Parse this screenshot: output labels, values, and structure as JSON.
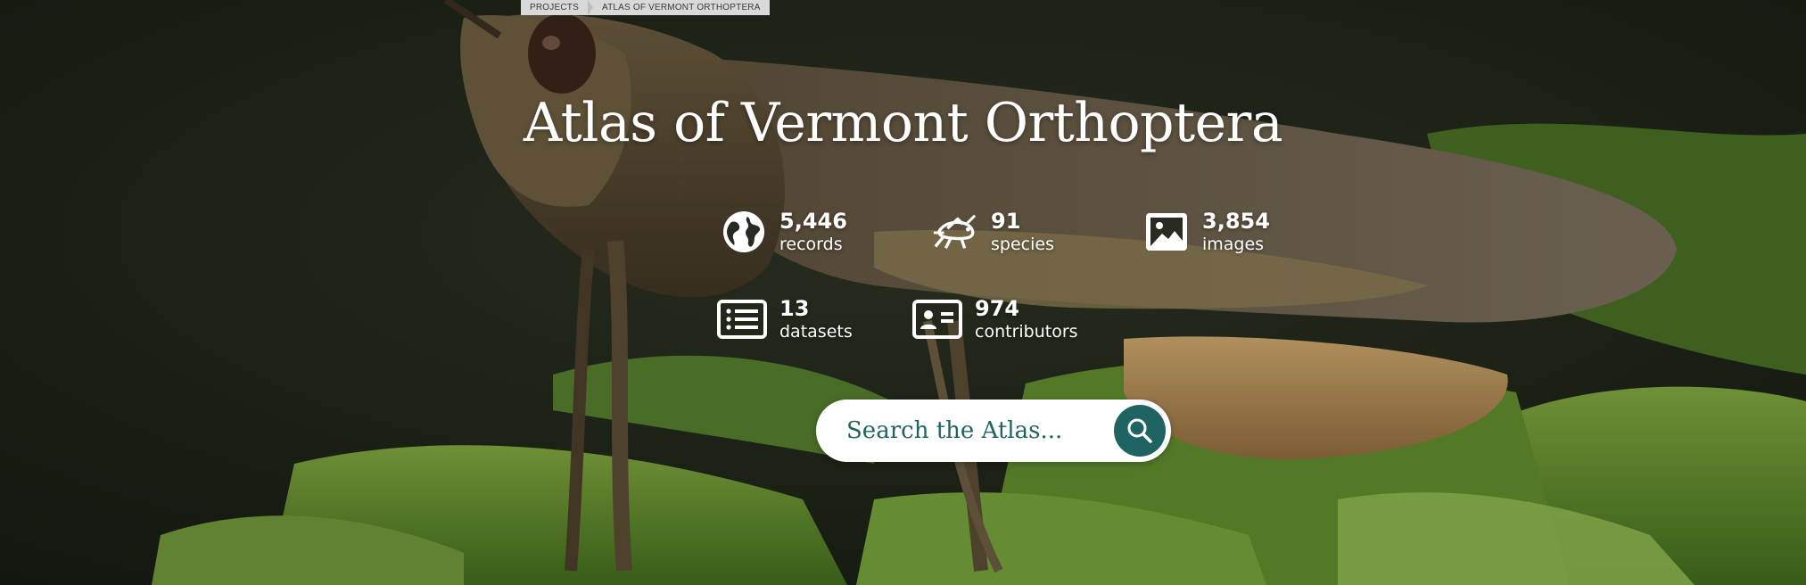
{
  "breadcrumb": {
    "items": [
      {
        "label": "PROJECTS"
      },
      {
        "label": "ATLAS OF VERMONT ORTHOPTERA"
      }
    ]
  },
  "hero": {
    "title": "Atlas of Vermont Orthoptera",
    "image": "grasshopper-on-fern-photo"
  },
  "stats": [
    {
      "value": "5,446",
      "label": "records",
      "icon": "globe-icon"
    },
    {
      "value": "91",
      "label": "species",
      "icon": "grasshopper-icon"
    },
    {
      "value": "3,854",
      "label": "images",
      "icon": "image-icon"
    },
    {
      "value": "13",
      "label": "datasets",
      "icon": "list-icon"
    },
    {
      "value": "974",
      "label": "contributors",
      "icon": "id-card-icon"
    }
  ],
  "search": {
    "placeholder": "Search the Atlas...",
    "button_icon": "search-icon"
  },
  "colors": {
    "search_button": "#1f6462",
    "search_text": "#1f6460",
    "breadcrumb_bg": "#d9d9d9",
    "title": "#ffffff"
  }
}
